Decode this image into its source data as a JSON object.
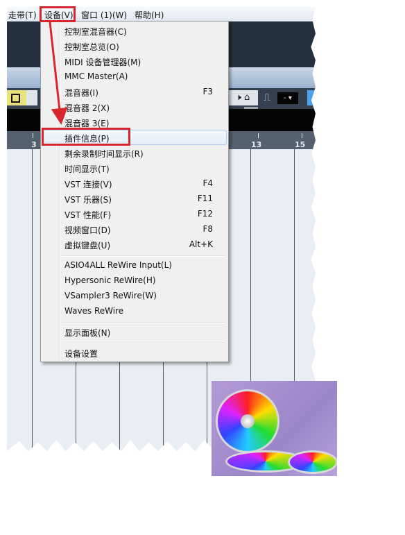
{
  "menubar": {
    "items": [
      {
        "label": "走带(T)"
      },
      {
        "label": "设备(V)",
        "active": true
      },
      {
        "label": "窗口 (1)(W)"
      },
      {
        "label": "帮助(H)"
      }
    ]
  },
  "toolbar": {
    "speaker_icon": "🕨",
    "tag_icon": "⌂",
    "step_icon": "⎍",
    "dropdown_value": "-"
  },
  "ruler": {
    "labels": [
      "3",
      "13",
      "15"
    ]
  },
  "devices_menu": {
    "items": [
      {
        "label": "控制室混音器(C)",
        "shortcut": ""
      },
      {
        "label": "控制室总览(O)",
        "shortcut": ""
      },
      {
        "label": "MIDI 设备管理器(M)",
        "shortcut": ""
      },
      {
        "label": "MMC Master(A)",
        "shortcut": ""
      },
      {
        "label": "混音器(I)",
        "shortcut": "F3"
      },
      {
        "label": "混音器 2(X)",
        "shortcut": ""
      },
      {
        "label": "混音器 3(E)",
        "shortcut": ""
      },
      {
        "label": "插件信息(P)",
        "shortcut": "",
        "highlighted": true
      },
      {
        "label": "剩余录制时间显示(R)",
        "shortcut": ""
      },
      {
        "label": "时间显示(T)",
        "shortcut": ""
      },
      {
        "label": "VST 连接(V)",
        "shortcut": "F4"
      },
      {
        "label": "VST 乐器(S)",
        "shortcut": "F11"
      },
      {
        "label": "VST 性能(F)",
        "shortcut": "F12"
      },
      {
        "label": "视频窗口(D)",
        "shortcut": "F8"
      },
      {
        "label": "虚拟键盘(U)",
        "shortcut": "Alt+K"
      },
      {
        "label": "ASIO4ALL ReWire Input(L)",
        "shortcut": ""
      },
      {
        "label": "Hypersonic ReWire(H)",
        "shortcut": ""
      },
      {
        "label": "VSampler3 ReWire(W)",
        "shortcut": ""
      },
      {
        "label": "Waves ReWire",
        "shortcut": ""
      },
      {
        "label": "显示面板(N)",
        "shortcut": ""
      },
      {
        "label": "设备设置",
        "shortcut": ""
      }
    ]
  },
  "annotation": {
    "color": "#d9262c"
  }
}
